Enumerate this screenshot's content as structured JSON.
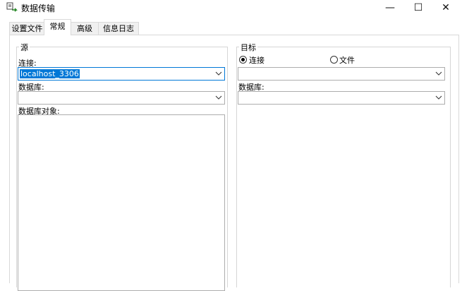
{
  "window": {
    "title": "数据传输",
    "minimize": "—",
    "maximize": "☐",
    "close": "✕"
  },
  "tabs": [
    {
      "label": "设置文件"
    },
    {
      "label": "常规"
    },
    {
      "label": "高级"
    },
    {
      "label": "信息日志"
    }
  ],
  "active_tab": "常规",
  "source": {
    "group_title": "源",
    "connection_label": "连接:",
    "connection_value": "localhost_3306",
    "database_label": "数据库:",
    "database_value": "",
    "objects_label": "数据库对象:"
  },
  "target": {
    "group_title": "目标",
    "radio_connection": "连接",
    "radio_file": "文件",
    "selected": "连接",
    "connection_value": "",
    "database_label": "数据库:",
    "database_value": ""
  },
  "colors": {
    "selection": "#0078d7",
    "border": "#adadad"
  }
}
